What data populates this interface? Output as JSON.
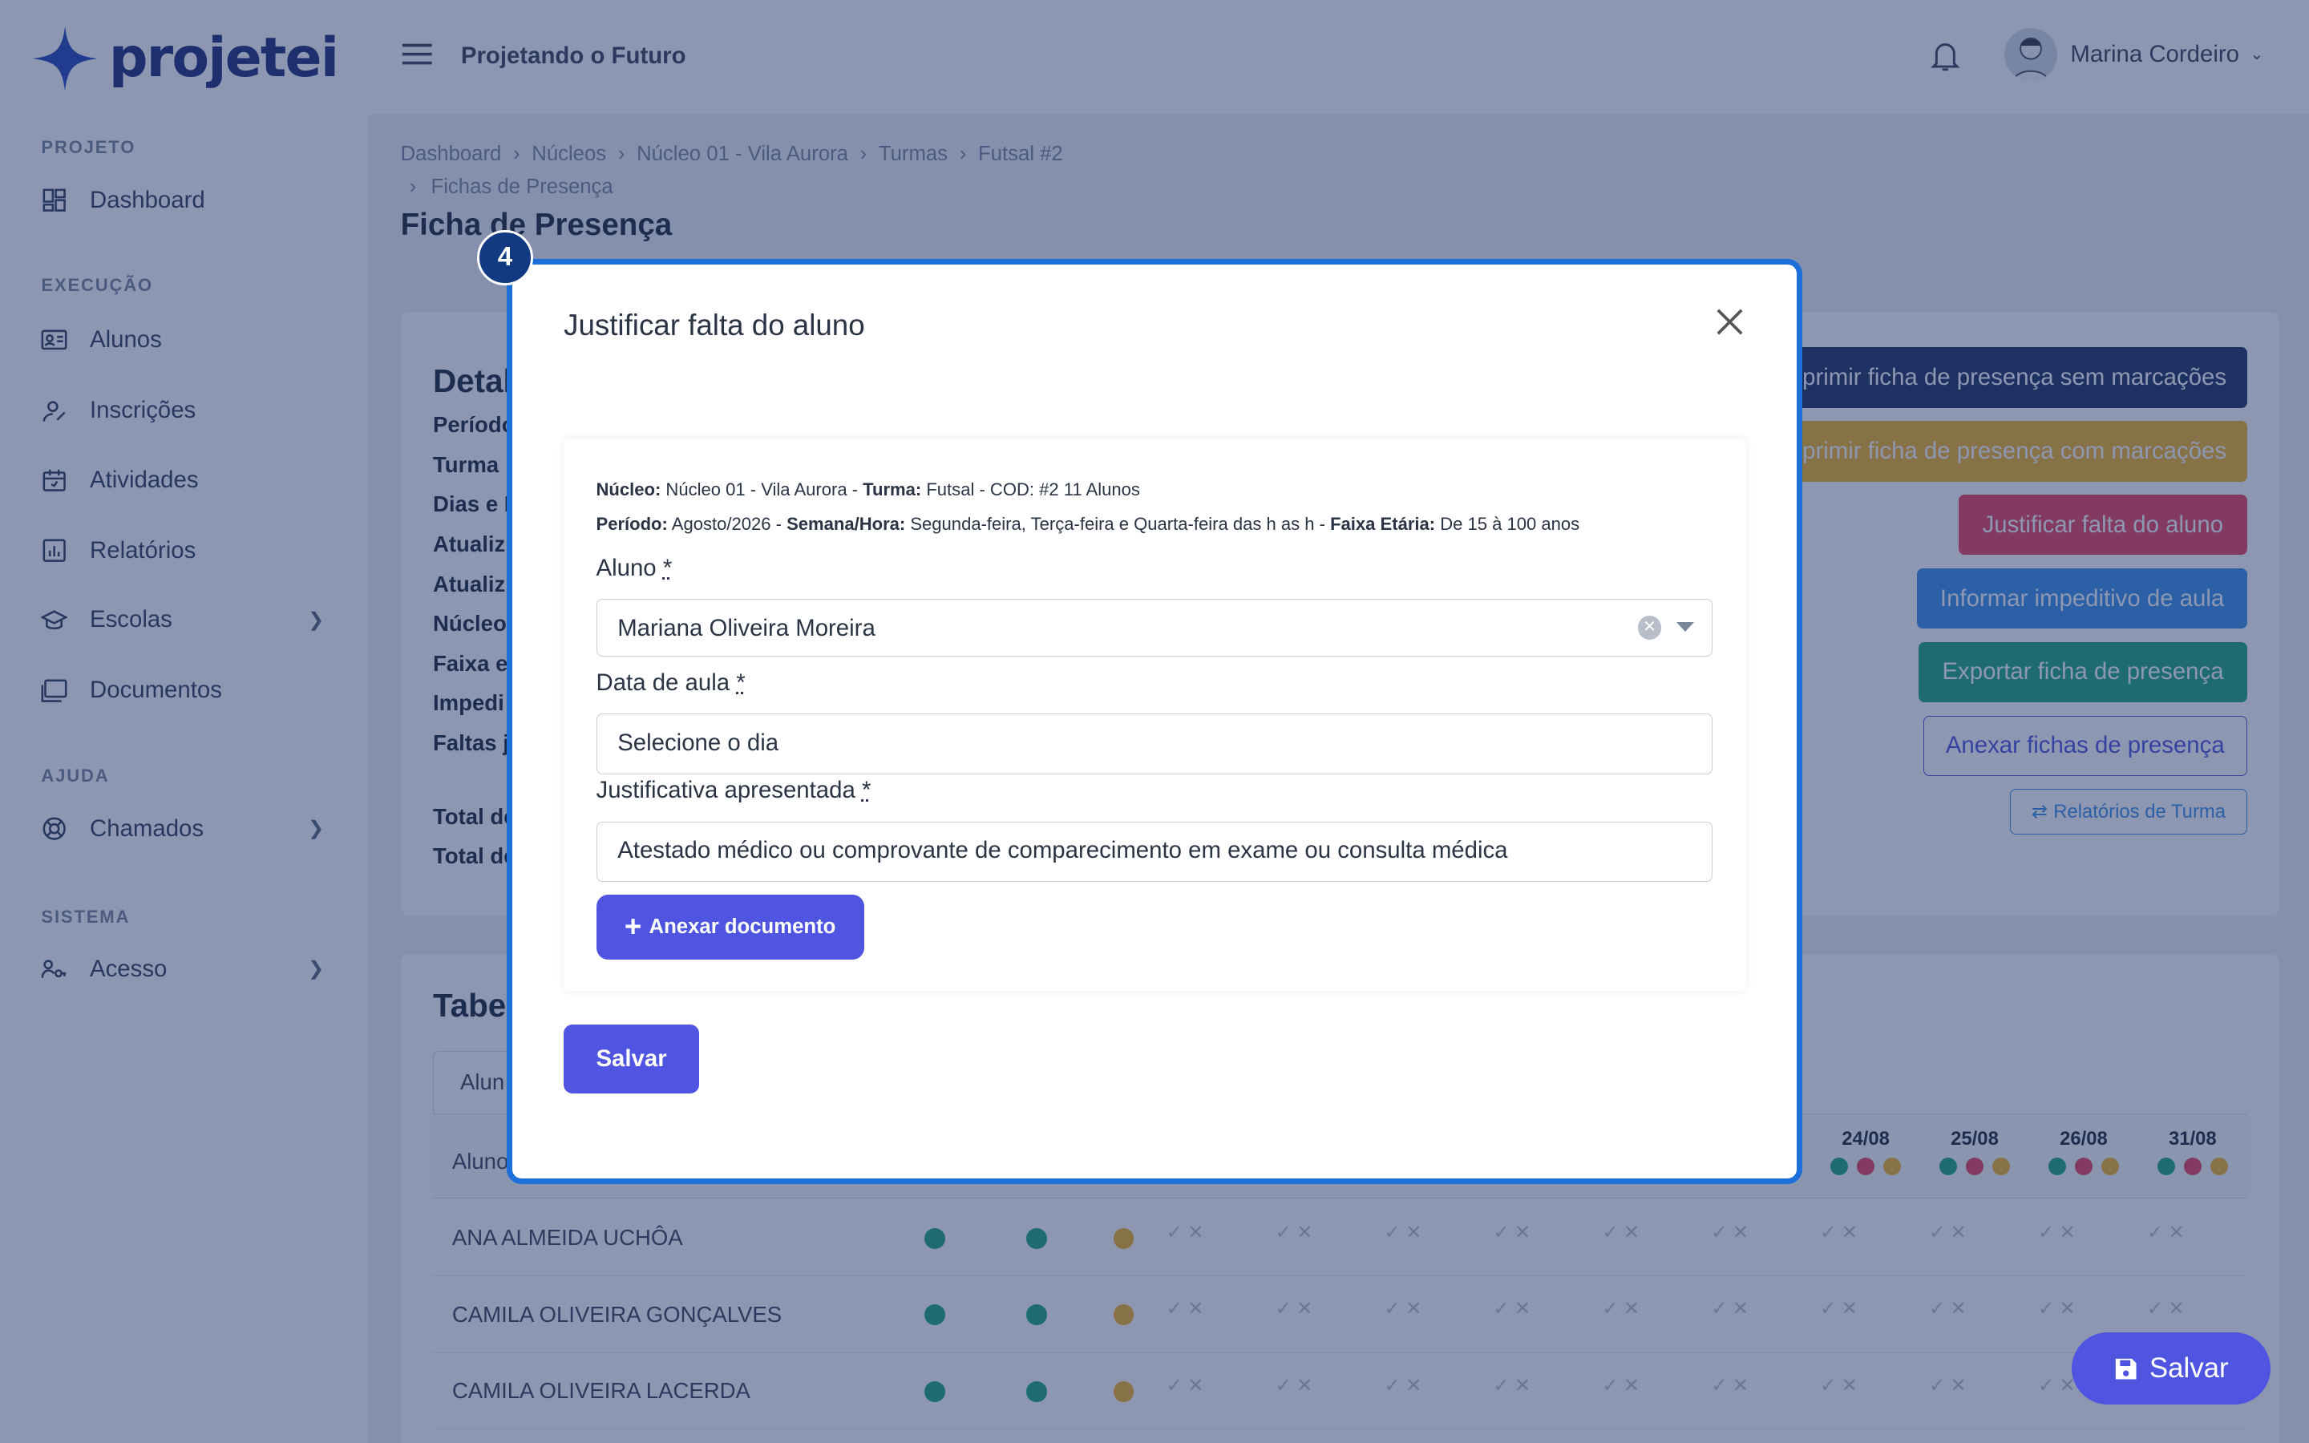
{
  "app": {
    "logo_text": "projetei",
    "project_name": "Projetando o Futuro"
  },
  "user": {
    "name": "Marina Cordeiro"
  },
  "sidebar": {
    "sections": [
      {
        "title": "PROJETO",
        "items": [
          {
            "label": "Dashboard",
            "icon": "dashboard-icon"
          }
        ]
      },
      {
        "title": "EXECUÇÃO",
        "items": [
          {
            "label": "Alunos",
            "icon": "id-card-icon"
          },
          {
            "label": "Inscrições",
            "icon": "user-edit-icon"
          },
          {
            "label": "Atividades",
            "icon": "calendar-icon"
          },
          {
            "label": "Relatórios",
            "icon": "bar-chart-icon"
          },
          {
            "label": "Escolas",
            "icon": "school-icon",
            "has_submenu": true
          },
          {
            "label": "Documentos",
            "icon": "folder-icon"
          }
        ]
      },
      {
        "title": "AJUDA",
        "items": [
          {
            "label": "Chamados",
            "icon": "lifebuoy-icon",
            "has_submenu": true
          }
        ]
      },
      {
        "title": "SISTEMA",
        "items": [
          {
            "label": "Acesso",
            "icon": "users-key-icon",
            "has_submenu": true
          }
        ]
      }
    ]
  },
  "breadcrumb": [
    "Dashboard",
    "Núcleos",
    "Núcleo 01 - Vila Aurora",
    "Turmas",
    "Futsal #2",
    "Fichas de Presença"
  ],
  "page_title": "Ficha de Presença",
  "details": {
    "title": "Detal",
    "labels": [
      "Período:",
      "Turma",
      "Dias e H",
      "Atualiz",
      "Atualiz",
      "Núcleo",
      "Faixa e",
      "Impedi",
      "Faltas j",
      "Total de",
      "Total de"
    ]
  },
  "actions": [
    {
      "label": "Imprimir ficha de presença sem marcações",
      "color": "#1f3560"
    },
    {
      "label": "Imprimir ficha de presença com marcações",
      "color": "#f0b429"
    },
    {
      "label": "Justificar falta do aluno",
      "color": "#e8445f"
    },
    {
      "label": "Informar impeditivo de aula",
      "color": "#3b8fe8"
    },
    {
      "label": "Exportar ficha de presença",
      "color": "#21a87a"
    },
    {
      "label": "Anexar fichas de presença",
      "color": "#4f55e0"
    },
    {
      "label": "Relatórios de Turma",
      "color": "#3b8fe8"
    }
  ],
  "table": {
    "title": "Tabe",
    "tab": "Alun",
    "col_aluno": "Aluno",
    "dates": [
      "24/08",
      "25/08",
      "26/08",
      "31/08"
    ],
    "rows": [
      {
        "name": "ANA ALMEIDA UCHÔA"
      },
      {
        "name": "CAMILA OLIVEIRA GONÇALVES"
      },
      {
        "name": "CAMILA OLIVEIRA LACERDA"
      }
    ]
  },
  "save_float": "Salvar",
  "modal": {
    "step": "4",
    "title": "Justificar falta do aluno",
    "info": {
      "nucleo_label": "Núcleo:",
      "nucleo_value": "Núcleo 01 - Vila Aurora -",
      "turma_label": "Turma:",
      "turma_value": "Futsal - COD: #2 11 Alunos",
      "periodo_label": "Período:",
      "periodo_value": "Agosto/2026 -",
      "semana_label": "Semana/Hora:",
      "semana_value": "Segunda-feira, Terça-feira e Quarta-feira das h as h -",
      "faixa_label": "Faixa Etária:",
      "faixa_value": "De 15 à 100 anos"
    },
    "aluno_label": "Aluno",
    "aluno_value": "Mariana Oliveira Moreira",
    "data_label": "Data de aula",
    "data_value": "Selecione o dia",
    "just_label": "Justificativa apresentada",
    "just_value": "Atestado médico ou comprovante de comparecimento em exame ou consulta médica",
    "attach_label": "Anexar documento",
    "save_label": "Salvar"
  }
}
